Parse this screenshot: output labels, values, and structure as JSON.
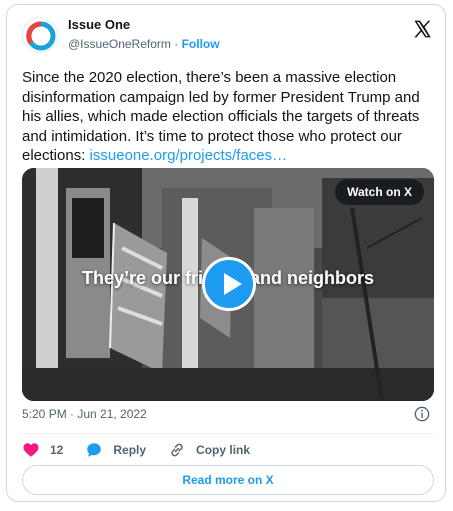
{
  "account": {
    "name": "Issue One",
    "handle": "@IssueOneReform",
    "separator": "·",
    "follow_label": "Follow"
  },
  "tweet": {
    "text": "Since the 2020 election, there’s been a massive election disinformation campaign led by former President Trump and his allies, which made election officials the targets of threats and intimidation. It’s time to protect those who protect our elections: ",
    "link_text": "issueone.org/projects/faces…",
    "timestamp": "5:20 PM · Jun 21, 2022"
  },
  "media": {
    "watch_label": "Watch on X",
    "overlay_text": "They’re our friends and neighbors"
  },
  "actions": {
    "like_count": "12",
    "reply_label": "Reply",
    "copy_label": "Copy link"
  },
  "footer": {
    "read_more_label": "Read more on X"
  },
  "colors": {
    "accent": "#1d9bf0",
    "like": "#f91880",
    "text": "#0f1419",
    "muted": "#536471",
    "border": "#cfd9de"
  },
  "icons": [
    "issue-one-logo-icon",
    "x-logo-icon",
    "play-icon",
    "info-icon",
    "heart-icon",
    "reply-bubble-icon",
    "link-icon"
  ]
}
